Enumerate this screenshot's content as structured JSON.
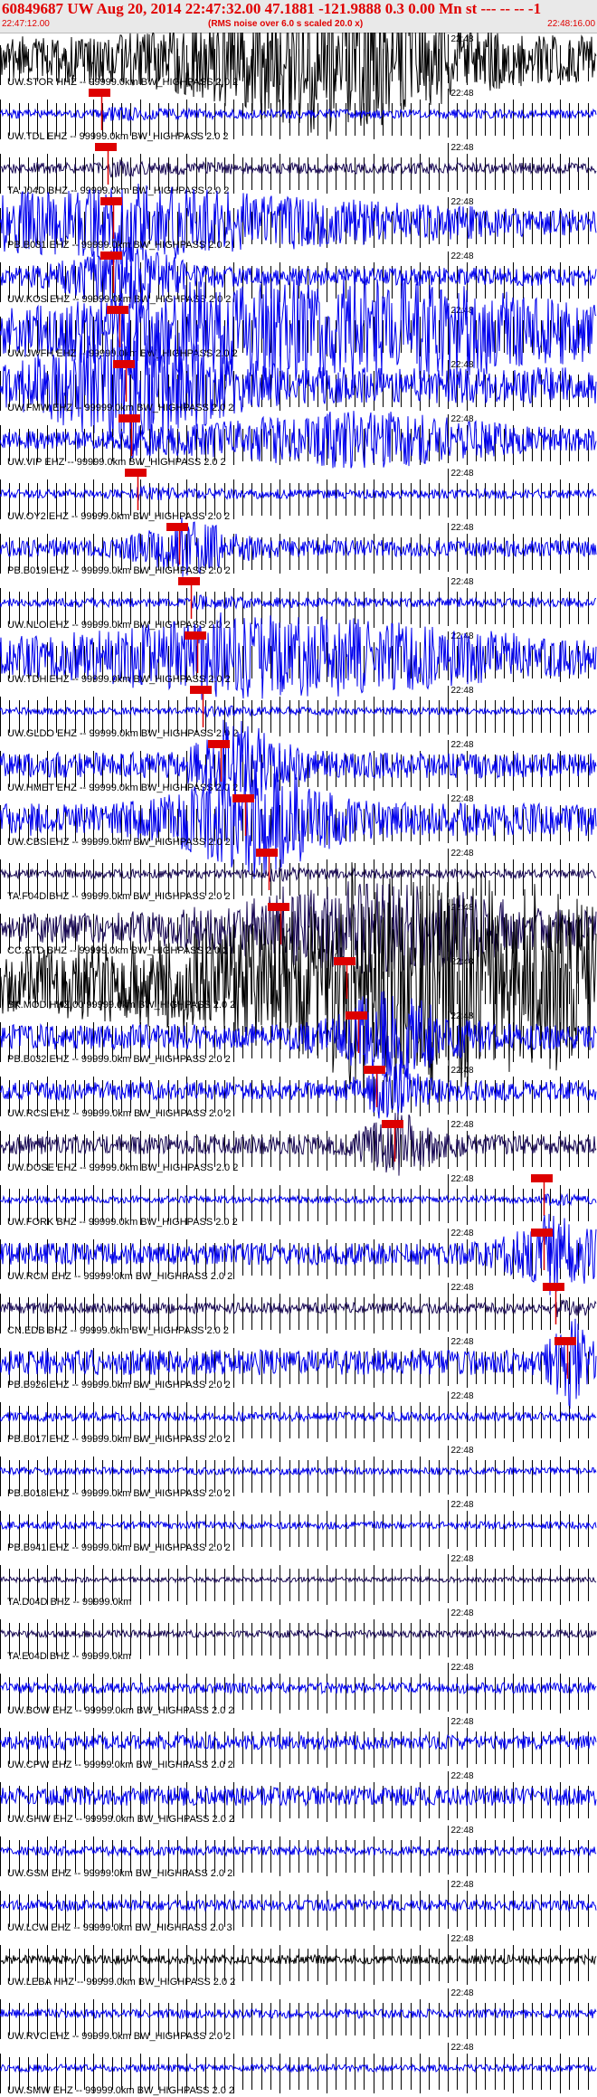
{
  "header": {
    "title": "60849687 UW Aug 20, 2014 22:47:32.00   47.1881 -121.9888  0.3 0.00 Mn st --- -- --  -1",
    "subtitle": "(RMS noise over 6.0 s scaled 20.0 x)",
    "start_time": "22:47:12.00",
    "end_time": "22:48:16.00"
  },
  "colors": {
    "header_text": "#e00000",
    "trace_blue": "#0000ee",
    "trace_dark": "#1a0a55",
    "trace_black": "#000000",
    "pick": "#dd0000",
    "grid": "#000000"
  },
  "chart_data": {
    "type": "line",
    "title": "60849687 UW Aug 20, 2014 22:47:32.00   47.1881 -121.9888  0.3 0.00 Mn st --- -- --  -1",
    "x_range": [
      "22:47:12.00",
      "22:48:16.00"
    ],
    "time_mark_label": "22:48",
    "time_mark": "22:48:00",
    "series": [
      {
        "name": "UW.STOR HHZ -- 99999.0km BW_HIGHPASS 2.0 2",
        "color": "#000000",
        "amp": 26,
        "burst": [
          0.55,
          0.2
        ],
        "pick": null
      },
      {
        "name": "UW.TDL EHZ -- 99999.0km BW_HIGHPASS 2.0 2",
        "color": "#0000ee",
        "amp": 5,
        "burst": null,
        "pick": 0.17
      },
      {
        "name": "TA.J04D BHZ -- 99999.0km BW_HIGHPASS 2.0 2",
        "color": "#1a0a55",
        "amp": 6,
        "burst": null,
        "pick": 0.18
      },
      {
        "name": "PB.B031 EHZ -- 99999.0km BW_HIGHPASS 2.0 2",
        "color": "#0000ee",
        "amp": 12,
        "burst": [
          0.18,
          0.5
        ],
        "pick": 0.19
      },
      {
        "name": "UW.KOS EHZ -- 99999.0km BW_HIGHPASS 2.0 2",
        "color": "#0000ee",
        "amp": 10,
        "burst": [
          0.2,
          0.1
        ],
        "pick": 0.19
      },
      {
        "name": "UW.JWFH EHZ -- 99999.0km BW_HIGHPASS 2.0 2",
        "color": "#0000ee",
        "amp": 20,
        "burst": [
          0.55,
          0.4
        ],
        "pick": 0.2
      },
      {
        "name": "UW.FMW EHZ -- 99999.0km BW_HIGHPASS 2.0 2",
        "color": "#0000ee",
        "amp": 20,
        "burst": [
          0.22,
          0.15
        ],
        "pick": 0.21
      },
      {
        "name": "UW.VIP EHZ -- 99999.0km BW_HIGHPASS 2.0 2",
        "color": "#0000ee",
        "amp": 10,
        "burst": [
          0.6,
          0.25
        ],
        "pick": 0.22
      },
      {
        "name": "UW.OY2 EHZ -- 99999.0km BW_HIGHPASS 2.0 2",
        "color": "#0000ee",
        "amp": 5,
        "burst": null,
        "pick": 0.23
      },
      {
        "name": "PB.B019 EHZ -- 99999.0km BW_HIGHPASS 2.0 2",
        "color": "#0000ee",
        "amp": 9,
        "burst": [
          0.31,
          0.08
        ],
        "pick": 0.3
      },
      {
        "name": "UW.NLO EHZ -- 99999.0km BW_HIGHPASS 2.0 2",
        "color": "#0000ee",
        "amp": 5,
        "burst": null,
        "pick": 0.32
      },
      {
        "name": "UW.TDH EHZ -- 99999.0km BW_HIGHPASS 2.0 2",
        "color": "#0000ee",
        "amp": 14,
        "burst": [
          0.48,
          0.4
        ],
        "pick": 0.33
      },
      {
        "name": "UW.GLDO EHZ -- 99999.0km BW_HIGHPASS 2.0 2",
        "color": "#0000ee",
        "amp": 4,
        "burst": null,
        "pick": 0.34
      },
      {
        "name": "UW.HMET EHZ -- 99999.0km BW_HIGHPASS 2.0 2",
        "color": "#0000ee",
        "amp": 14,
        "burst": [
          0.4,
          0.07
        ],
        "pick": 0.37
      },
      {
        "name": "UW.CBS EHZ -- 99999.0km BW_HIGHPASS 2.0 2",
        "color": "#0000ee",
        "amp": 18,
        "burst": [
          0.42,
          0.12
        ],
        "pick": 0.41
      },
      {
        "name": "TA.F04D BHZ -- 99999.0km BW_HIGHPASS 2.0 2",
        "color": "#1a0a55",
        "amp": 5,
        "burst": null,
        "pick": 0.45
      },
      {
        "name": "CC.STD BHZ -- 99999.0km BW_HIGHPASS 2.0 2",
        "color": "#1a0a55",
        "amp": 16,
        "burst": [
          0.62,
          0.25
        ],
        "pick": 0.47
      },
      {
        "name": "BK.MOD HHZ.00 99999.0km BW_HIGHPASS 2.0 2",
        "color": "#000000",
        "amp": 38,
        "burst": [
          0.75,
          0.35
        ],
        "pick": 0.58
      },
      {
        "name": "PB.B032 EHZ -- 99999.0km BW_HIGHPASS 2.0 2",
        "color": "#0000ee",
        "amp": 14,
        "burst": [
          0.66,
          0.1
        ],
        "pick": 0.6
      },
      {
        "name": "UW.RCS EHZ -- 99999.0km BW_HIGHPASS 2.0 2",
        "color": "#0000ee",
        "amp": 10,
        "burst": [
          0.65,
          0.05
        ],
        "pick": 0.63
      },
      {
        "name": "UW.DOSE EHZ -- 99999.0km BW_HIGHPASS 2.0 2",
        "color": "#1a0a55",
        "amp": 10,
        "burst": [
          0.66,
          0.06
        ],
        "pick": 0.66
      },
      {
        "name": "UW.FORK BHZ -- 99999.0km BW_HIGHPASS 2.0 2",
        "color": "#0000ee",
        "amp": 4,
        "burst": null,
        "pick": 0.91
      },
      {
        "name": "UW.RCM EHZ -- 99999.0km BW_HIGHPASS 2.0 2",
        "color": "#0000ee",
        "amp": 12,
        "burst": [
          0.93,
          0.08
        ],
        "pick": 0.91
      },
      {
        "name": "CN.EDB BHZ -- 99999.0km BW_HIGHPASS 2.0 2",
        "color": "#1a0a55",
        "amp": 6,
        "burst": null,
        "pick": 0.93
      },
      {
        "name": "PB.B926 EHZ -- 99999.0km BW_HIGHPASS 2.0 2",
        "color": "#0000ee",
        "amp": 14,
        "burst": [
          0.95,
          0.03
        ],
        "pick": 0.95
      },
      {
        "name": "PB.B017 EHZ -- 99999.0km BW_HIGHPASS 2.0 2",
        "color": "#0000ee",
        "amp": 5,
        "burst": null,
        "pick": null
      },
      {
        "name": "PB.B018 EHZ -- 99999.0km BW_HIGHPASS 2.0 2",
        "color": "#0000ee",
        "amp": 4,
        "burst": null,
        "pick": null
      },
      {
        "name": "PB.B941 EHZ -- 99999.0km BW_HIGHPASS 2.0 2",
        "color": "#0000ee",
        "amp": 4,
        "burst": null,
        "pick": null
      },
      {
        "name": "TA.D04D BHZ -- 99999.0km",
        "color": "#1a0a55",
        "amp": 3,
        "burst": null,
        "pick": null
      },
      {
        "name": "TA.E04D BHZ -- 99999.0km",
        "color": "#1a0a55",
        "amp": 4,
        "burst": null,
        "pick": null
      },
      {
        "name": "UW.BOW EHZ -- 99999.0km BW_HIGHPASS 2.0 2",
        "color": "#0000ee",
        "amp": 6,
        "burst": null,
        "pick": null
      },
      {
        "name": "UW.CPW EHZ -- 99999.0km BW_HIGHPASS 2.0 2",
        "color": "#0000ee",
        "amp": 8,
        "burst": null,
        "pick": null
      },
      {
        "name": "UW.GHW EHZ -- 99999.0km BW_HIGHPASS 2.0 2",
        "color": "#0000ee",
        "amp": 10,
        "burst": null,
        "pick": null
      },
      {
        "name": "UW.GSM EHZ -- 99999.0km BW_HIGHPASS 2.0 2",
        "color": "#0000ee",
        "amp": 5,
        "burst": null,
        "pick": null
      },
      {
        "name": "UW.LCW EHZ -- 99999.0km BW_HIGHPASS 2.0 3",
        "color": "#0000ee",
        "amp": 6,
        "burst": null,
        "pick": null
      },
      {
        "name": "UW.LEBA HHZ -- 99999.0km BW_HIGHPASS 2.0 2",
        "color": "#000000",
        "amp": 5,
        "burst": null,
        "pick": null
      },
      {
        "name": "UW.RVC EHZ -- 99999.0km BW_HIGHPASS 2.0 2",
        "color": "#0000ee",
        "amp": 5,
        "burst": null,
        "pick": null
      },
      {
        "name": "UW.SMW EHZ -- 99999.0km BW_HIGHPASS 2.0 2",
        "color": "#0000ee",
        "amp": 4,
        "burst": null,
        "pick": null
      }
    ]
  }
}
